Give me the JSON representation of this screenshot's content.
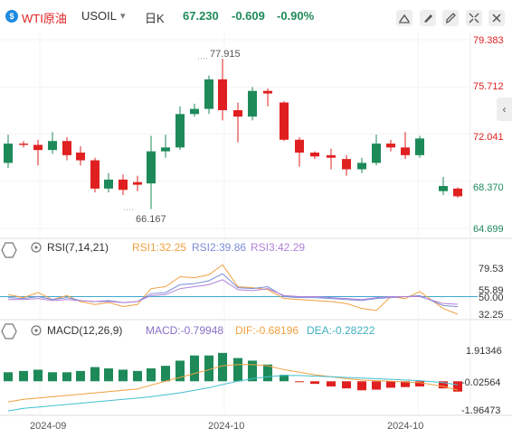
{
  "header": {
    "symbol_badge": "$",
    "symbol": "WTI原油",
    "exchange": "USOIL",
    "dropdown_glyph": "▾",
    "interval": "日K",
    "last": "67.230",
    "change": "-0.609",
    "change_pct": "-0.90%",
    "colors": {
      "up": "#1e8a5a",
      "down": "#e02020",
      "accent": "#1f8be0"
    },
    "tool_icons": [
      "line-tool-icon",
      "brush-tool-icon",
      "pencil-tool-icon",
      "fullscreen-icon",
      "close-icon"
    ]
  },
  "chart_data": [
    {
      "type": "candlestick",
      "title": "",
      "ylim": [
        64.699,
        79.383
      ],
      "y_ticks": [
        "79.383",
        "75.712",
        "72.041",
        "68.370",
        "64.699"
      ],
      "x_ticks": [
        "2024-09",
        "2024-10",
        "2024-10"
      ],
      "annotations": {
        "high_label": "77.915",
        "low_label": "66.167"
      },
      "up_color": "#1e8a5a",
      "down_color": "#e02020",
      "candles": [
        {
          "o": 69.8,
          "h": 72.0,
          "l": 69.4,
          "c": 71.3
        },
        {
          "o": 71.3,
          "h": 71.5,
          "l": 71.0,
          "c": 71.2
        },
        {
          "o": 71.2,
          "h": 71.6,
          "l": 69.6,
          "c": 70.8
        },
        {
          "o": 70.8,
          "h": 72.2,
          "l": 70.5,
          "c": 71.5
        },
        {
          "o": 71.5,
          "h": 71.8,
          "l": 70.0,
          "c": 70.4
        },
        {
          "o": 70.6,
          "h": 71.1,
          "l": 69.6,
          "c": 70.0
        },
        {
          "o": 70.0,
          "h": 70.2,
          "l": 67.5,
          "c": 67.8
        },
        {
          "o": 67.8,
          "h": 69.0,
          "l": 67.5,
          "c": 68.5
        },
        {
          "o": 68.5,
          "h": 68.9,
          "l": 67.3,
          "c": 67.7
        },
        {
          "o": 68.3,
          "h": 68.8,
          "l": 67.6,
          "c": 68.1
        },
        {
          "o": 68.2,
          "h": 71.9,
          "l": 66.2,
          "c": 70.7
        },
        {
          "o": 70.7,
          "h": 72.0,
          "l": 70.2,
          "c": 71.0
        },
        {
          "o": 71.0,
          "h": 74.2,
          "l": 70.8,
          "c": 73.6
        },
        {
          "o": 73.6,
          "h": 74.4,
          "l": 73.4,
          "c": 74.0
        },
        {
          "o": 74.0,
          "h": 76.6,
          "l": 73.6,
          "c": 76.3
        },
        {
          "o": 76.3,
          "h": 77.9,
          "l": 73.1,
          "c": 73.9
        },
        {
          "o": 73.9,
          "h": 74.5,
          "l": 71.4,
          "c": 73.4
        },
        {
          "o": 73.4,
          "h": 75.7,
          "l": 73.1,
          "c": 75.4
        },
        {
          "o": 75.4,
          "h": 75.6,
          "l": 74.2,
          "c": 75.2
        },
        {
          "o": 74.5,
          "h": 74.6,
          "l": 71.5,
          "c": 71.6
        },
        {
          "o": 71.6,
          "h": 71.8,
          "l": 69.5,
          "c": 70.6
        },
        {
          "o": 70.6,
          "h": 70.7,
          "l": 70.1,
          "c": 70.3
        },
        {
          "o": 70.4,
          "h": 70.9,
          "l": 69.3,
          "c": 70.2
        },
        {
          "o": 70.1,
          "h": 70.4,
          "l": 68.8,
          "c": 69.3
        },
        {
          "o": 69.3,
          "h": 70.2,
          "l": 69.0,
          "c": 69.8
        },
        {
          "o": 69.8,
          "h": 72.0,
          "l": 69.6,
          "c": 71.3
        },
        {
          "o": 71.3,
          "h": 71.6,
          "l": 70.7,
          "c": 71.0
        },
        {
          "o": 71.0,
          "h": 72.2,
          "l": 70.1,
          "c": 70.4
        },
        {
          "o": 70.4,
          "h": 71.9,
          "l": 70.2,
          "c": 71.7
        },
        {
          "o": 67.6,
          "h": 68.7,
          "l": 67.3,
          "c": 68.0
        },
        {
          "o": 67.8,
          "h": 67.9,
          "l": 67.1,
          "c": 67.2
        }
      ]
    },
    {
      "type": "line",
      "title": "RSI(7,14,21)",
      "ylim": [
        32.25,
        79.53
      ],
      "y_ticks": [
        "79.53",
        "55.89",
        "50.00",
        "32.25"
      ],
      "labels": [
        "RSI1:32.25",
        "RSI2:39.86",
        "RSI3:42.29"
      ],
      "reference_value": 50,
      "series": [
        {
          "name": "RSI1",
          "color": "#f0a040",
          "values": [
            52,
            49,
            54,
            47,
            51,
            45,
            42,
            44,
            40,
            42,
            58,
            60,
            70,
            69,
            72,
            82,
            60,
            59,
            57,
            48,
            47,
            46,
            45,
            43,
            38,
            36,
            50,
            48,
            55,
            38,
            32.25
          ]
        },
        {
          "name": "RSI2",
          "color": "#7a8cd8",
          "values": [
            49,
            48,
            50,
            47,
            49,
            46,
            45,
            46,
            44,
            45,
            53,
            54,
            62,
            63,
            66,
            73,
            59,
            58,
            60,
            50,
            49,
            49,
            48,
            47,
            46,
            48,
            49,
            50,
            51,
            41,
            39.86
          ]
        },
        {
          "name": "RSI3",
          "color": "#b180d8",
          "values": [
            47,
            47,
            48,
            46,
            47,
            46,
            45,
            45,
            44,
            45,
            51,
            52,
            58,
            60,
            62,
            67,
            57,
            56,
            58,
            51,
            50,
            50,
            49,
            48,
            47,
            49,
            50,
            50,
            50,
            43,
            42.29
          ]
        }
      ]
    },
    {
      "type": "bar+line",
      "title": "MACD(12,26,9)",
      "ylim": [
        -2.5,
        3.1
      ],
      "y_ticks": [
        "1.91346",
        "-0.02564",
        "-1.96473"
      ],
      "labels": [
        "MACD:-0.79948",
        "DIF:-0.68196",
        "DEA:-0.28222"
      ],
      "series": [
        {
          "name": "MACD",
          "values": [
            0.7,
            0.8,
            0.9,
            0.7,
            0.7,
            0.8,
            1.1,
            1.0,
            0.9,
            0.8,
            1.0,
            1.2,
            1.6,
            2.0,
            2.0,
            2.2,
            1.8,
            1.6,
            1.3,
            0.5,
            -0.05,
            -0.2,
            -0.4,
            -0.55,
            -0.7,
            -0.65,
            -0.5,
            -0.45,
            -0.4,
            -0.55,
            -0.8
          ]
        },
        {
          "name": "DIF",
          "color": "#f0a040",
          "values": [
            -1.6,
            -1.4,
            -1.3,
            -1.2,
            -1.1,
            -1.0,
            -0.9,
            -0.8,
            -0.7,
            -0.6,
            -0.3,
            0.0,
            0.3,
            0.6,
            0.9,
            1.2,
            1.3,
            1.3,
            1.2,
            0.9,
            0.7,
            0.5,
            0.35,
            0.2,
            0.1,
            0.05,
            0.0,
            -0.05,
            -0.1,
            -0.4,
            -0.68
          ]
        },
        {
          "name": "DEA",
          "color": "#40c0d0",
          "values": [
            -2.3,
            -2.1,
            -2.0,
            -1.9,
            -1.8,
            -1.7,
            -1.6,
            -1.5,
            -1.4,
            -1.3,
            -1.2,
            -1.05,
            -0.9,
            -0.7,
            -0.5,
            -0.25,
            0.0,
            0.2,
            0.35,
            0.45,
            0.45,
            0.4,
            0.35,
            0.3,
            0.25,
            0.2,
            0.15,
            0.1,
            0.05,
            -0.1,
            -0.28
          ]
        }
      ]
    }
  ]
}
